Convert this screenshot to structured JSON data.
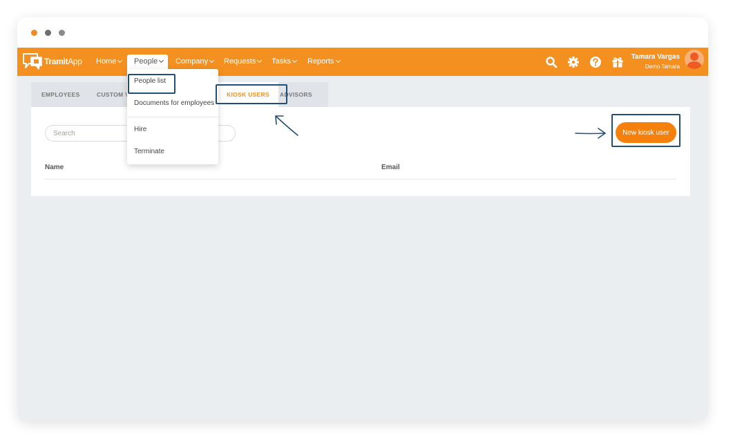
{
  "brand": {
    "name_bold": "Tramit",
    "name_light": "App"
  },
  "nav": {
    "items": [
      {
        "label": "Home"
      },
      {
        "label": "People"
      },
      {
        "label": "Company"
      },
      {
        "label": "Requests"
      },
      {
        "label": "Tasks"
      },
      {
        "label": "Reports"
      }
    ]
  },
  "topbar": {
    "icons": [
      "search-icon",
      "gear-icon",
      "help-icon",
      "gift-icon"
    ],
    "user_name": "Tamara Vargas",
    "user_company": "Demo Tamara"
  },
  "people_menu": {
    "items": [
      {
        "label": "People list"
      },
      {
        "label": "Documents for employees"
      },
      {
        "label": "Hire"
      },
      {
        "label": "Terminate"
      }
    ]
  },
  "tabs": [
    {
      "label": "EMPLOYEES"
    },
    {
      "label": "CUSTOM VA"
    },
    {
      "label": "KIOSK USERS"
    },
    {
      "label": "ADVISORS"
    }
  ],
  "search": {
    "placeholder": "Search"
  },
  "table": {
    "columns": [
      "Name",
      "Email"
    ]
  },
  "actions": {
    "new_kiosk_user": "New kiosk user"
  },
  "colors": {
    "brand_orange": "#f39020",
    "button_orange": "#f5810c",
    "highlight_blue": "#1f4e79"
  }
}
